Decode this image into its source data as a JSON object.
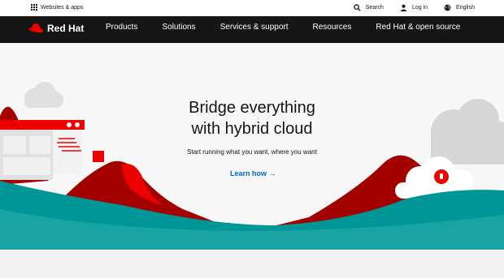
{
  "utility_bar": {
    "websites_label": "Websites & apps",
    "search_label": "Search",
    "login_label": "Log in",
    "language_label": "English"
  },
  "nav": {
    "brand": "Red Hat",
    "items": [
      "Products",
      "Solutions",
      "Services & support",
      "Resources",
      "Red Hat & open source"
    ]
  },
  "hero": {
    "title_line1": "Bridge everything",
    "title_line2": "with hybrid cloud",
    "subtitle": "Start running what you want, where you want",
    "cta": "Learn how →"
  },
  "colors": {
    "brand_red": "#ee0000",
    "dark_red": "#a30000",
    "teal": "#009596",
    "nav_bg": "#151515",
    "link_blue": "#0066cc"
  }
}
